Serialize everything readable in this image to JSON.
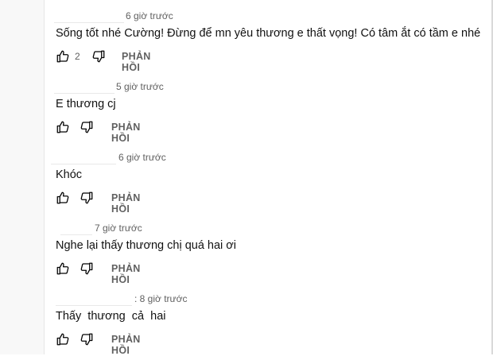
{
  "comments": [
    {
      "author_name": "",
      "timestamp": "6 giờ trước",
      "text": "Sống tốt nhé Cường! Đừng để mn yêu thương e thất vọng! Có tâm ắt có tầm e nhé",
      "likes": "2",
      "reply_label": "PHẢN HỒI"
    },
    {
      "author_name": "",
      "timestamp": "5 giờ trước",
      "text": "E thương cj",
      "likes": "",
      "reply_label": "PHẢN HỒI"
    },
    {
      "author_name": "",
      "timestamp": "6 giờ trước",
      "text": "Khóc",
      "likes": "",
      "reply_label": "PHẢN HỒI"
    },
    {
      "author_name": "",
      "timestamp": "7 giờ trước",
      "text": "Nghe lại thấy thương chị quá hai ơi",
      "likes": "",
      "reply_label": "PHẢN HỒI"
    },
    {
      "author_name": "",
      "timestamp": ": 8 giờ trước",
      "text": "Thấy  thương  cả  hai",
      "likes": "",
      "reply_label": "PHẢN HỒI"
    }
  ],
  "icons": {
    "like": "thumbs-up-icon",
    "dislike": "thumbs-down-icon"
  }
}
